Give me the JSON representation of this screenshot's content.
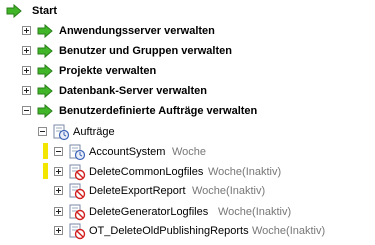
{
  "tree": {
    "root": {
      "label": "Start",
      "icon": "green-arrow-icon"
    },
    "sections": [
      {
        "label": "Anwendungsserver verwalten",
        "expanded": false
      },
      {
        "label": "Benutzer und Gruppen verwalten",
        "expanded": false
      },
      {
        "label": "Projekte verwalten",
        "expanded": false
      },
      {
        "label": "Datenbank-Server verwalten",
        "expanded": false
      },
      {
        "label": "Benutzerdefinierte Aufträge verwalten",
        "expanded": true
      }
    ],
    "folder": {
      "label": "Aufträge",
      "icon": "folder-schedule-icon",
      "expanded": true
    },
    "jobs": [
      {
        "name": "AccountSystem",
        "schedule": "Woche",
        "expanded": true,
        "highlighted": true,
        "icon": "job-active-icon"
      },
      {
        "name": "DeleteCommonLogfiles",
        "schedule": "Woche(Inaktiv)",
        "expanded": false,
        "highlighted": true,
        "icon": "job-inactive-icon"
      },
      {
        "name": "DeleteExportReport",
        "schedule": "Woche(Inaktiv)",
        "expanded": false,
        "highlighted": false,
        "icon": "job-inactive-icon"
      },
      {
        "name": "DeleteGeneratorLogfiles",
        "schedule": "Woche(Inaktiv)",
        "expanded": false,
        "highlighted": false,
        "icon": "job-inactive-icon"
      },
      {
        "name": "OT_DeleteOldPublishingReports",
        "schedule": "Woche(Inaktiv)",
        "expanded": false,
        "highlighted": false,
        "icon": "job-inactive-icon"
      }
    ]
  }
}
